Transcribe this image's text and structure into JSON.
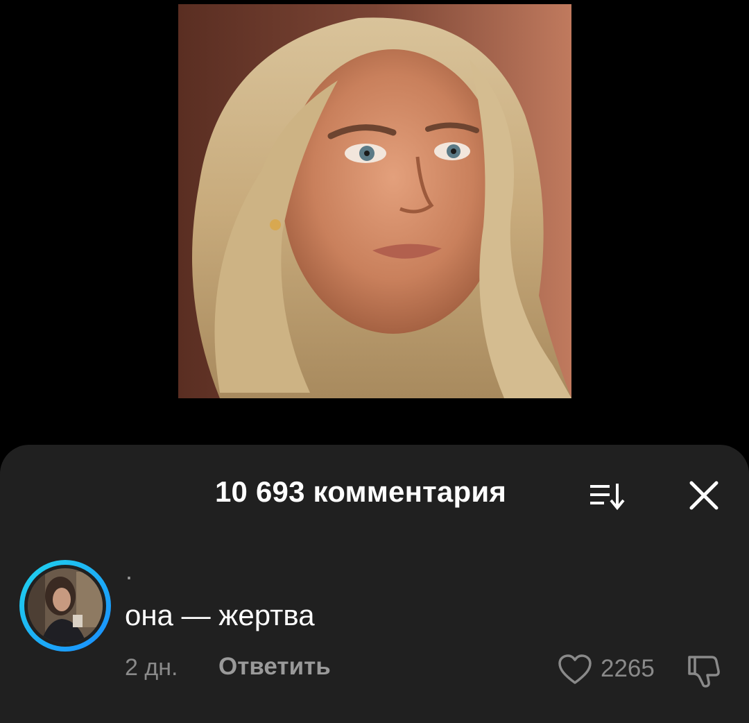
{
  "video": {
    "thumbnail_icon": "woman-portrait-image"
  },
  "comments_sheet": {
    "title": "10 693 комментария",
    "sort_icon": "sort-icon",
    "close_icon": "close-icon"
  },
  "comment": {
    "username": "·",
    "text": "она — жертва",
    "time": "2 дн.",
    "reply_label": "Ответить",
    "like_count": "2265",
    "like_icon": "heart-icon",
    "dislike_icon": "thumbs-down-icon",
    "avatar_icon": "user-avatar"
  },
  "colors": {
    "background": "#000000",
    "sheet": "#202020",
    "text_primary": "#ffffff",
    "text_secondary": "#8a8a8a",
    "avatar_ring_start": "#20d5ec",
    "avatar_ring_end": "#1a8cff"
  }
}
